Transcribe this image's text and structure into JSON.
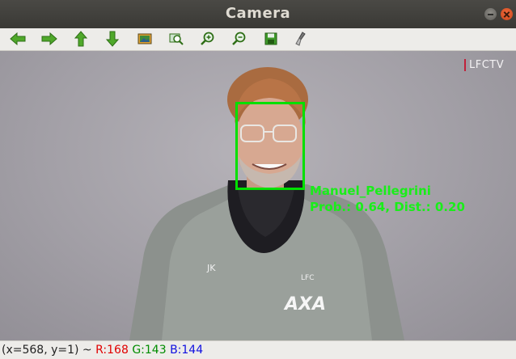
{
  "window": {
    "title": "Camera"
  },
  "toolbar": {
    "buttons": [
      {
        "icon": "arrow-left-icon"
      },
      {
        "icon": "arrow-right-icon"
      },
      {
        "icon": "arrow-up-icon"
      },
      {
        "icon": "arrow-down-icon"
      },
      {
        "icon": "image-icon"
      },
      {
        "icon": "zoom-fit-icon"
      },
      {
        "icon": "zoom-in-icon"
      },
      {
        "icon": "zoom-out-icon"
      },
      {
        "icon": "save-icon"
      },
      {
        "icon": "properties-icon"
      }
    ]
  },
  "canvas": {
    "watermark": "LFCTV",
    "box_color": "#00e000",
    "label_color": "#19ee19",
    "detection": {
      "name": "Manuel_Pellegrini",
      "prob_text": "Prob.: 0.64, Dist.: 0.20"
    },
    "jacket_text": {
      "initials": "JK",
      "club": "LFC",
      "sponsor": "AXA"
    }
  },
  "status": {
    "coords": "(x=568, y=1) ~ ",
    "r": "R:168",
    "g": "G:143",
    "b": "B:144"
  }
}
